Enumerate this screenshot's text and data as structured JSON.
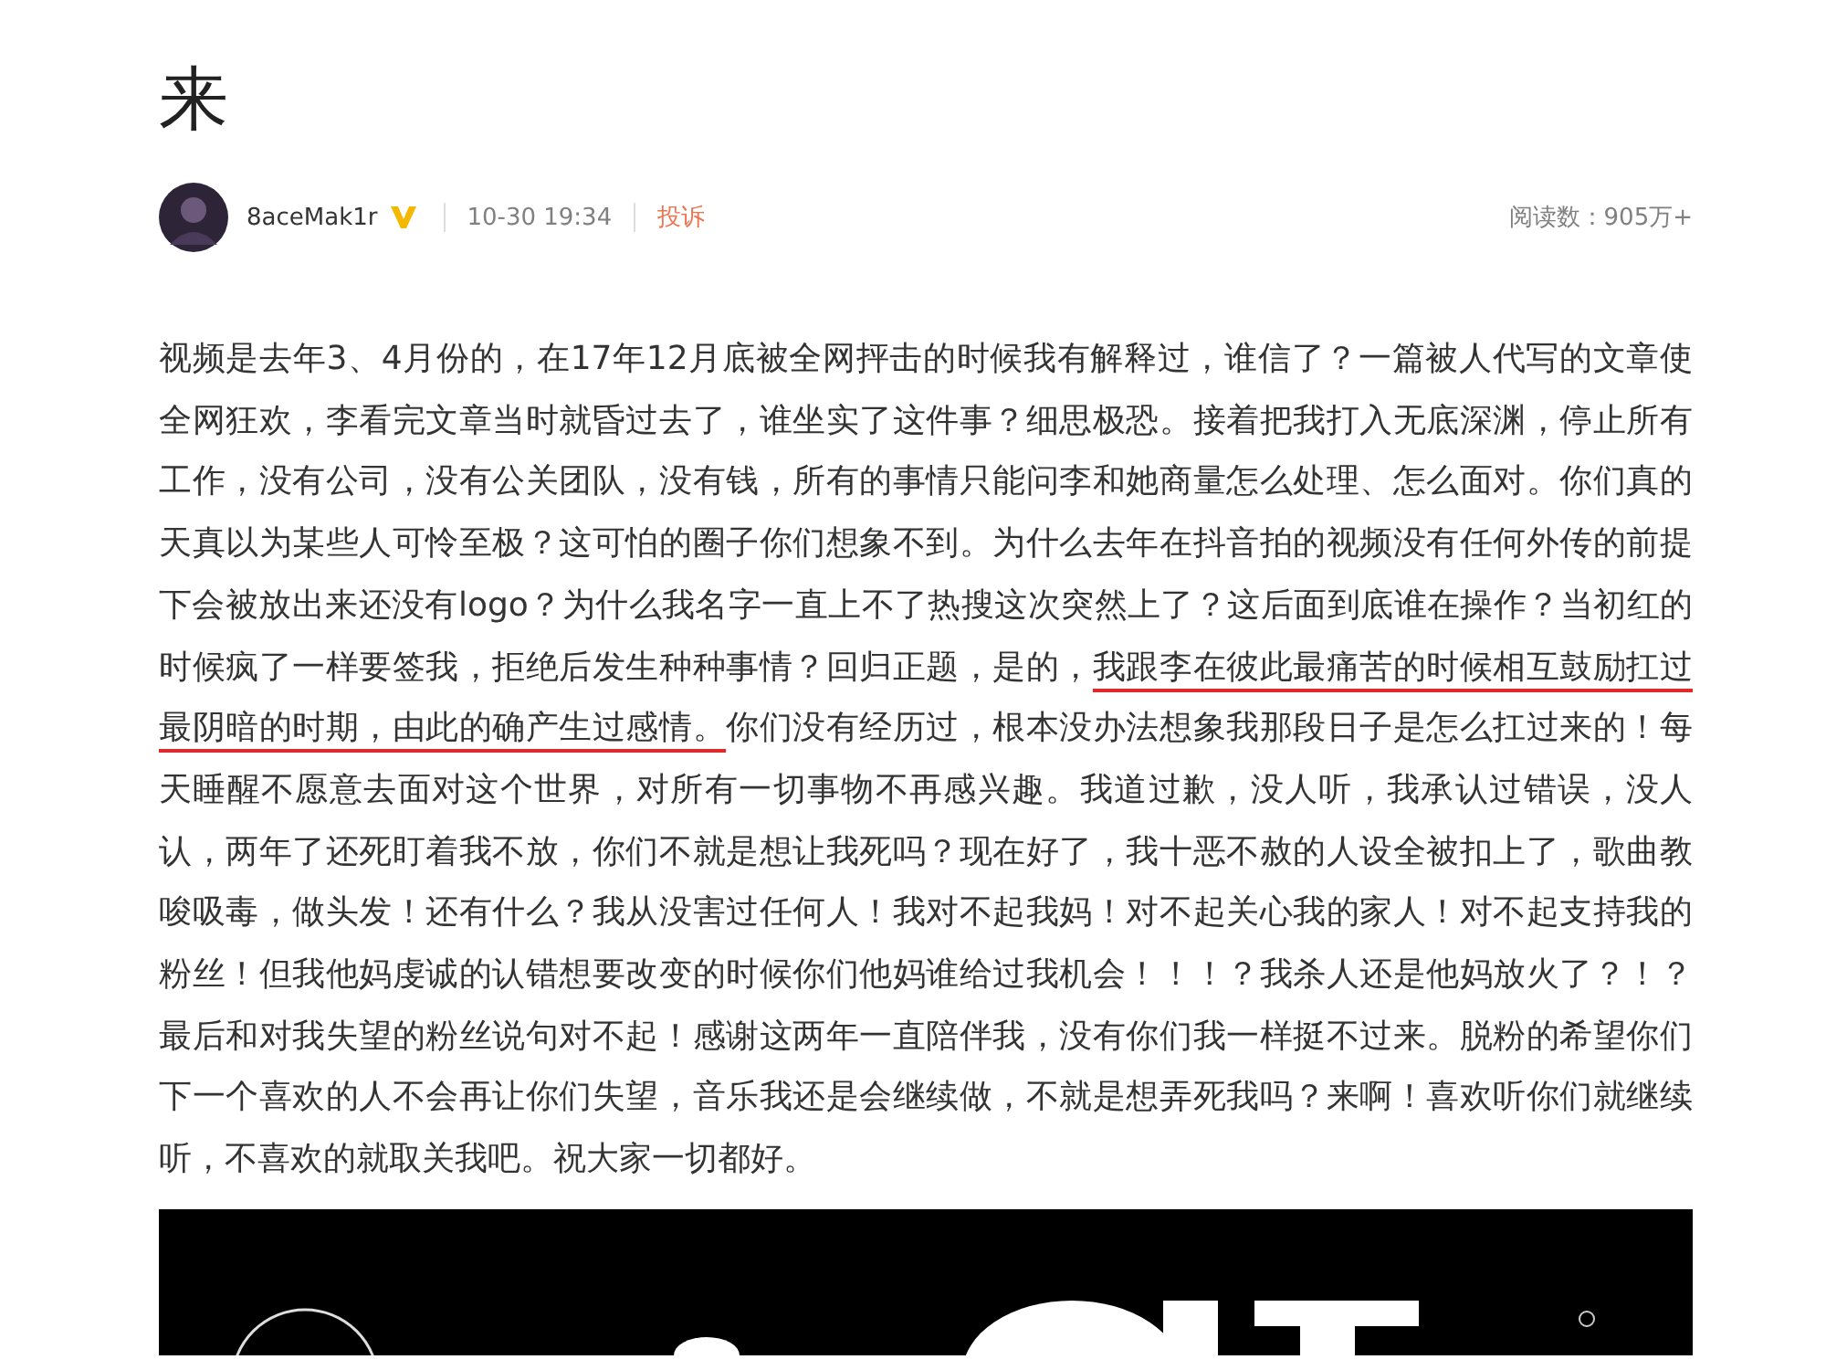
{
  "title": "来",
  "meta": {
    "author": "8aceMak1r",
    "verified": true,
    "time": "10-30 19:34",
    "report": "投诉",
    "reads": "阅读数：905万+"
  },
  "body": {
    "before": "视频是去年3、4月份的，在17年12月底被全网抨击的时候我有解释过，谁信了？一篇被人代写的文章使全网狂欢，李看完文章当时就昏过去了，谁坐实了这件事？细思极恐。接着把我打入无底深渊，停止所有工作，没有公司，没有公关团队，没有钱，所有的事情只能问李和她商量怎么处理、怎么面对。你们真的天真以为某些人可怜至极？这可怕的圈子你们想象不到。为什么去年在抖音拍的视频没有任何外传的前提下会被放出来还没有logo？为什么我名字一直上不了热搜这次突然上了？这后面到底谁在操作？当初红的时候疯了一样要签我，拒绝后发生种种事情？回归正题，是的，",
    "underlined": "我跟李在彼此最痛苦的时候相互鼓励扛过最阴暗的时期，由此的确产生过感情。",
    "after": "你们没有经历过，根本没办法想象我那段日子是怎么扛过来的！每天睡醒不愿意去面对这个世界，对所有一切事物不再感兴趣。我道过歉，没人听，我承认过错误，没人认，两年了还死盯着我不放，你们不就是想让我死吗？现在好了，我十恶不赦的人设全被扣上了，歌曲教唆吸毒，做头发！还有什么？我从没害过任何人！我对不起我妈！对不起关心我的家人！对不起支持我的粉丝！但我他妈虔诚的认错想要改变的时候你们他妈谁给过我机会！！！？我杀人还是他妈放火了？！？最后和对我失望的粉丝说句对不起！感谢这两年一直陪伴我，没有你们我一样挺不过来。脱粉的希望你们下一个喜欢的人不会再让你们失望，音乐我还是会继续做，不就是想弄死我吗？来啊！喜欢听你们就继续听，不喜欢的就取关我吧。祝大家一切都好。"
  }
}
